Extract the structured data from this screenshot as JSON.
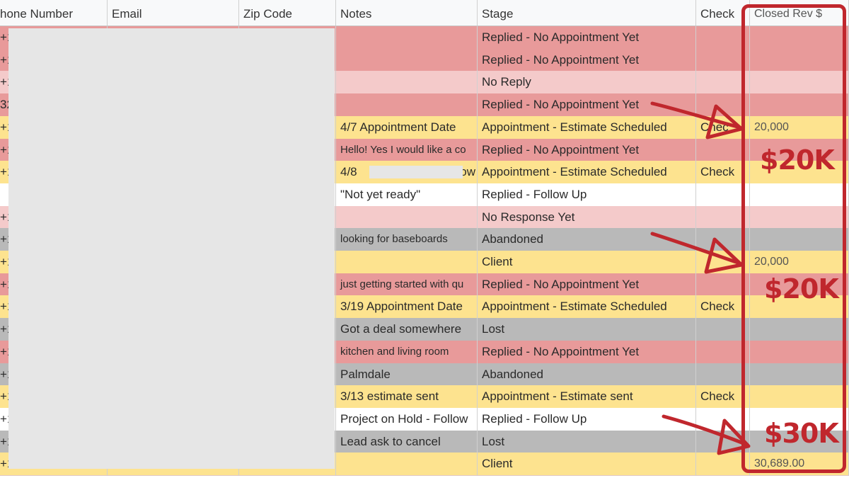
{
  "headers": {
    "phone": "hone Number",
    "email": "Email",
    "zip": "Zip Code",
    "notes": "Notes",
    "stage": "Stage",
    "check": "Check",
    "closed_rev": "Closed Rev $"
  },
  "rows": [
    {
      "phone": "+1",
      "notes": "",
      "stage": "Replied - No Appointment Yet",
      "check": "",
      "rev": ""
    },
    {
      "phone": "+1",
      "notes": "",
      "stage": "Replied - No Appointment Yet",
      "check": "",
      "rev": ""
    },
    {
      "phone": "+1",
      "notes": "",
      "stage": "No Reply",
      "check": "",
      "rev": ""
    },
    {
      "phone": "32",
      "notes": "",
      "stage": "Replied - No Appointment Yet",
      "check": "",
      "rev": ""
    },
    {
      "phone": "+1",
      "notes": "4/7 Appointment Date",
      "stage": "Appointment - Estimate Scheduled",
      "check": "Chec",
      "rev": "20,000"
    },
    {
      "phone": "+1",
      "notes": "Hello! Yes I would like a co",
      "stage": "Replied - No Appointment Yet",
      "check": "",
      "rev": ""
    },
    {
      "phone": "+1",
      "notes": "4/8",
      "notes_suffix": "low",
      "stage": "Appointment - Estimate Scheduled",
      "check": "Check",
      "rev": ""
    },
    {
      "phone": "",
      "notes": "\"Not yet ready\"",
      "stage": "Replied - Follow Up",
      "check": "",
      "rev": ""
    },
    {
      "phone": "+1",
      "notes": "",
      "stage": "No Response Yet",
      "check": "",
      "rev": ""
    },
    {
      "phone": "+1",
      "notes": "looking for baseboards",
      "stage": "Abandoned",
      "check": "",
      "rev": ""
    },
    {
      "phone": "+1",
      "notes": "",
      "stage": "Client",
      "check": "",
      "rev": "20,000"
    },
    {
      "phone": "+1",
      "notes": "just getting started with qu",
      "stage": "Replied - No Appointment Yet",
      "check": "",
      "rev": ""
    },
    {
      "phone": "+1",
      "notes": "3/19 Appointment Date",
      "stage": "Appointment - Estimate Scheduled",
      "check": "Check",
      "rev": ""
    },
    {
      "phone": "+1",
      "notes": "Got a deal somewhere",
      "stage": "Lost",
      "check": "",
      "rev": ""
    },
    {
      "phone": "+1",
      "notes": "kitchen and living room",
      "stage": "Replied - No Appointment Yet",
      "check": "",
      "rev": ""
    },
    {
      "phone": "+1",
      "notes": "Palmdale",
      "stage": "Abandoned",
      "check": "",
      "rev": ""
    },
    {
      "phone": "+1",
      "notes": "3/13 estimate sent",
      "stage": "Appointment - Estimate sent",
      "check": "Check",
      "rev": ""
    },
    {
      "phone": "+1",
      "notes": "Project on Hold - Follow",
      "stage": "Replied - Follow Up",
      "check": "",
      "rev": ""
    },
    {
      "phone": "+1",
      "notes": "Lead ask to cancel",
      "stage": "Lost",
      "check": "",
      "rev": ""
    },
    {
      "phone": "+1",
      "notes": "",
      "stage": "Client",
      "check": "",
      "rev": "30,689.00"
    }
  ],
  "row_colors": [
    "#e89a9a",
    "#e89a9a",
    "#f4caca",
    "#e89a9a",
    "#fde38f",
    "#e89a9a",
    "#fde38f",
    "#ffffff",
    "#f4caca",
    "#b9b9b9",
    "#fde38f",
    "#e89a9a",
    "#fde38f",
    "#b9b9b9",
    "#e89a9a",
    "#b9b9b9",
    "#fde38f",
    "#ffffff",
    "#b9b9b9",
    "#fde38f"
  ],
  "annotations": {
    "callout_1": "$20K",
    "callout_2": "$20K",
    "callout_3": "$30K",
    "accent_color": "#c0272d"
  }
}
